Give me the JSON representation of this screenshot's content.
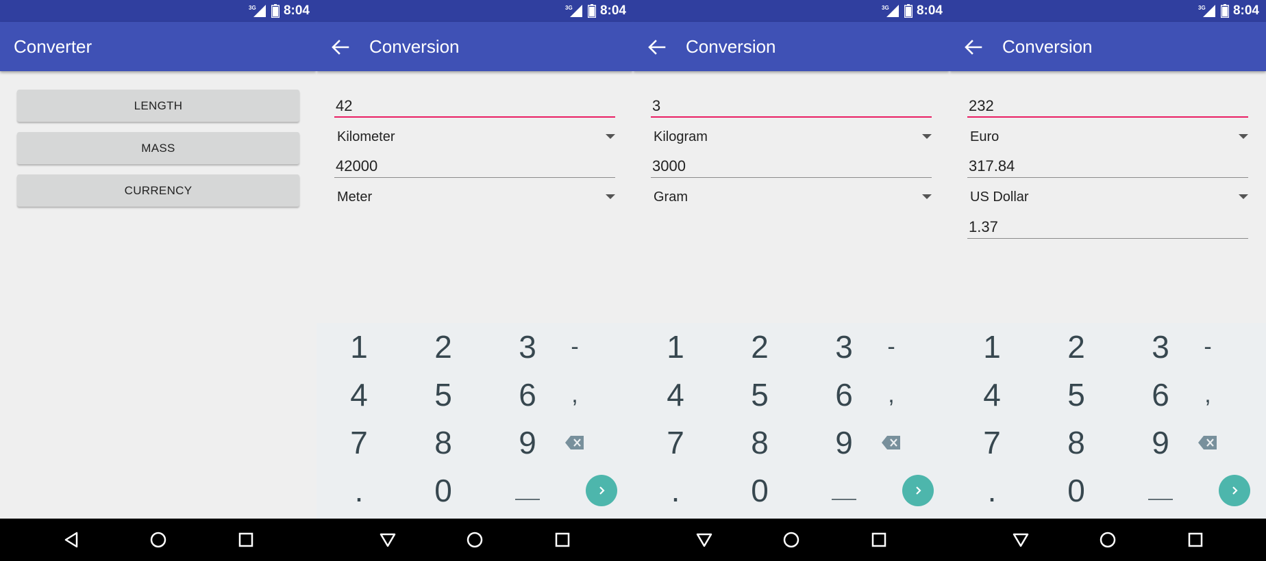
{
  "status": {
    "time": "8:04",
    "network": "3G"
  },
  "colors": {
    "status_bar": "#303f9f",
    "app_bar": "#3f51b5",
    "accent": "#e91e63",
    "go_key": "#4db6ac"
  },
  "screen1": {
    "title": "Converter",
    "buttons": [
      "LENGTH",
      "MASS",
      "CURRENCY"
    ]
  },
  "screens": [
    {
      "title": "Conversion",
      "input": "42",
      "from_unit": "Kilometer",
      "output": "42000",
      "to_unit": "Meter",
      "rate": null
    },
    {
      "title": "Conversion",
      "input": "3",
      "from_unit": "Kilogram",
      "output": "3000",
      "to_unit": "Gram",
      "rate": null
    },
    {
      "title": "Conversion",
      "input": "232",
      "from_unit": "Euro",
      "output": "317.84",
      "to_unit": "US Dollar",
      "rate": "1.37"
    }
  ],
  "keyboard": {
    "rows": [
      [
        "1",
        "2",
        "3",
        "-"
      ],
      [
        "4",
        "5",
        "6",
        ","
      ],
      [
        "7",
        "8",
        "9",
        "backspace-icon"
      ],
      [
        ".",
        "0",
        "space-key",
        "go-icon"
      ]
    ]
  },
  "icons": {
    "back": "arrow-left-icon",
    "nav": [
      "back-triangle-icon",
      "home-circle-icon",
      "recents-square-icon"
    ]
  }
}
